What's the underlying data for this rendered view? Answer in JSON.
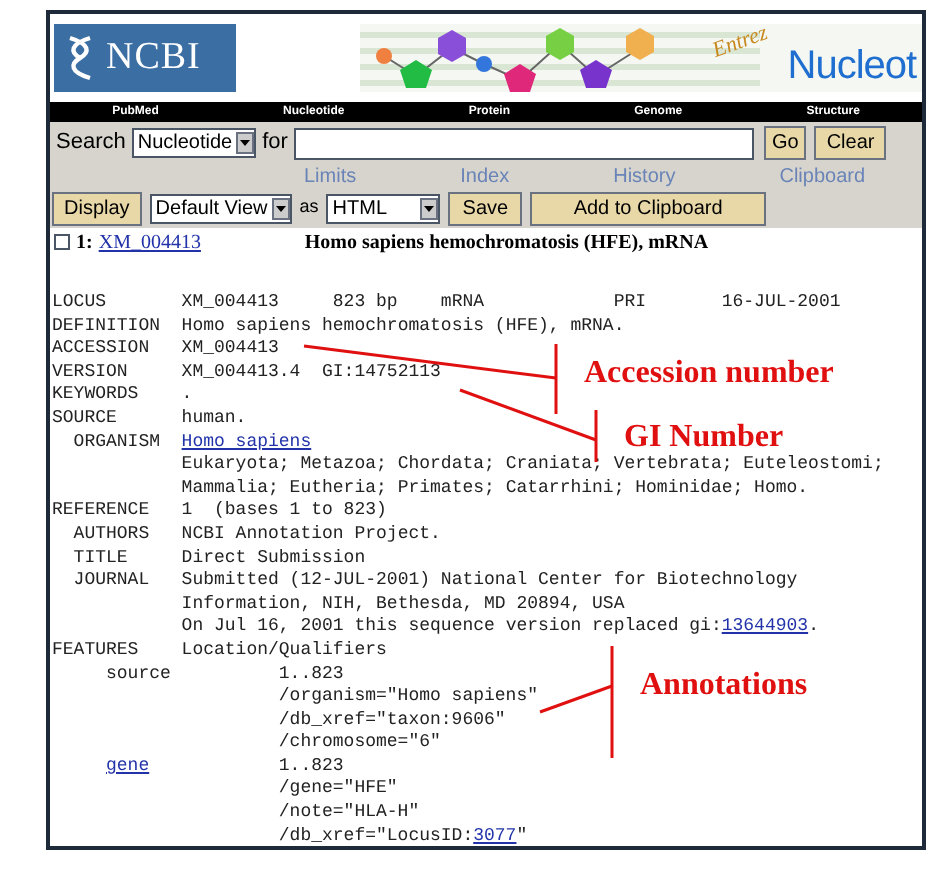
{
  "header": {
    "logo": "NCBI",
    "banner_title": "Entrez",
    "banner_subtitle": "Nucleot"
  },
  "nav": [
    "PubMed",
    "Nucleotide",
    "Protein",
    "Genome",
    "Structure"
  ],
  "search": {
    "label": "Search",
    "database": "Nucleotide",
    "for_label": "for",
    "buttons": [
      "Go",
      "Clear"
    ]
  },
  "links": [
    "Limits",
    "Index",
    "History",
    "Clipboard"
  ],
  "display_bar": {
    "button": "Display",
    "view": "Default View",
    "as_label": "as",
    "format": "HTML",
    "buttons": [
      "Save",
      "Add to Clipboard"
    ]
  },
  "record": {
    "checked": false,
    "number": "1:",
    "accession": "XM_004413",
    "title": "Homo sapiens hemochromatosis (HFE), mRNA"
  },
  "lines": [
    {
      "kind": "field",
      "label": "LOCUS",
      "value": [
        {
          "text": "XM_004413     823 bp    mRNA            PRI       16-JUL-2001",
          "link": false
        }
      ]
    },
    {
      "kind": "field",
      "label": "DEFINITION",
      "value": [
        {
          "text": "Homo sapiens hemochromatosis (HFE), mRNA.",
          "link": false
        }
      ]
    },
    {
      "kind": "field",
      "label": "ACCESSION",
      "value": [
        {
          "text": "XM_004413",
          "link": false
        }
      ]
    },
    {
      "kind": "field",
      "label": "VERSION",
      "value": [
        {
          "text": "XM_004413.4  GI:14752113",
          "link": false
        }
      ]
    },
    {
      "kind": "field",
      "label": "KEYWORDS",
      "value": [
        {
          "text": ".",
          "link": false
        }
      ]
    },
    {
      "kind": "field",
      "label": "SOURCE",
      "value": [
        {
          "text": "human.",
          "link": false
        }
      ]
    },
    {
      "kind": "subfield",
      "label": "ORGANISM",
      "value": [
        {
          "text": "Homo sapiens",
          "link": true
        }
      ]
    },
    {
      "kind": "field",
      "value": [
        {
          "text": "Eukaryota; Metazoa; Chordata; Craniata; Vertebrata; Euteleostomi;",
          "link": false
        }
      ]
    },
    {
      "kind": "field",
      "value": [
        {
          "text": "Mammalia; Eutheria; Primates; Catarrhini; Hominidae; Homo.",
          "link": false
        }
      ]
    },
    {
      "kind": "field",
      "label": "REFERENCE",
      "value": [
        {
          "text": "1  (bases 1 to 823)",
          "link": false
        }
      ]
    },
    {
      "kind": "subfield",
      "label": "AUTHORS",
      "value": [
        {
          "text": "NCBI Annotation Project.",
          "link": false
        }
      ]
    },
    {
      "kind": "subfield",
      "label": "TITLE",
      "value": [
        {
          "text": "Direct Submission",
          "link": false
        }
      ]
    },
    {
      "kind": "subfield",
      "label": "JOURNAL",
      "value": [
        {
          "text": "Submitted (12-JUL-2001) National Center for Biotechnology",
          "link": false
        }
      ]
    },
    {
      "kind": "field",
      "value": [
        {
          "text": "Information, NIH, Bethesda, MD 20894, USA",
          "link": false
        }
      ]
    },
    {
      "kind": "field",
      "value": [
        {
          "text": "On Jul 16, 2001 this sequence version replaced gi:",
          "link": false
        },
        {
          "text": "13644903",
          "link": true
        },
        {
          "text": ".",
          "link": false
        }
      ]
    },
    {
      "kind": "field",
      "label": "FEATURES",
      "value": [
        {
          "text": "Location/Qualifiers",
          "link": false
        }
      ]
    },
    {
      "kind": "feature",
      "label": "source",
      "link": false,
      "value": [
        {
          "text": "1..823",
          "link": false
        }
      ]
    },
    {
      "kind": "feature",
      "value": [
        {
          "text": "/organism=\"Homo sapiens\"",
          "link": false
        }
      ]
    },
    {
      "kind": "feature",
      "value": [
        {
          "text": "/db_xref=\"taxon:9606\"",
          "link": false
        }
      ]
    },
    {
      "kind": "feature",
      "value": [
        {
          "text": "/chromosome=\"6\"",
          "link": false
        }
      ]
    },
    {
      "kind": "feature",
      "label": "gene",
      "link": true,
      "value": [
        {
          "text": "1..823",
          "link": false
        }
      ]
    },
    {
      "kind": "feature",
      "value": [
        {
          "text": "/gene=\"HFE\"",
          "link": false
        }
      ]
    },
    {
      "kind": "feature",
      "value": [
        {
          "text": "/note=\"HLA-H\"",
          "link": false
        }
      ]
    },
    {
      "kind": "feature",
      "value": [
        {
          "text": "/db_xref=\"LocusID:",
          "link": false
        },
        {
          "text": "3077",
          "link": true
        },
        {
          "text": "\"",
          "link": false
        }
      ]
    }
  ],
  "annotations": [
    {
      "label": "Accession number"
    },
    {
      "label": "GI Number"
    },
    {
      "label": "Annotations"
    }
  ]
}
